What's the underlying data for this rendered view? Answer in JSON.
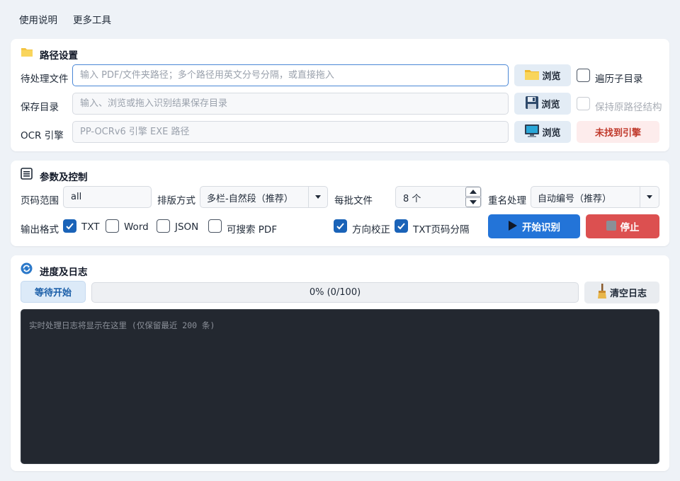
{
  "menu": {
    "usage": "使用说明",
    "more_tools": "更多工具"
  },
  "path_settings": {
    "title": "路径设置",
    "input_label": "待处理文件",
    "input_placeholder": "输入 PDF/文件夹路径；多个路径用英文分号分隔，或直接拖入",
    "output_label": "保存目录",
    "output_placeholder": "输入、浏览或拖入识别结果保存目录",
    "engine_label": "OCR 引擎",
    "engine_placeholder": "PP-OCRv6 引擎 EXE 路径",
    "browse_label": "浏览",
    "recursive_label": "遍历子目录",
    "keep_structure_label": "保持原路径结构",
    "engine_status": "未找到引擎"
  },
  "params": {
    "title": "参数及控制",
    "page_range_label": "页码范围",
    "page_range_value": "all",
    "layout_label": "排版方式",
    "layout_value": "多栏-自然段（推荐）",
    "batch_label": "每批文件",
    "batch_value": "8 个",
    "rename_label": "重名处理",
    "rename_value": "自动编号（推荐）",
    "output_format_label": "输出格式",
    "formats": [
      "TXT",
      "Word",
      "JSON",
      "可搜索 PDF"
    ],
    "orientation_label": "方向校正",
    "txt_page_sep_label": "TXT页码分隔",
    "start_label": "开始识别",
    "stop_label": "停止"
  },
  "progress": {
    "title": "进度及日志",
    "status": "等待开始",
    "progress_text": "0%  (0/100)",
    "progress_fraction": 0,
    "clear_label": "清空日志",
    "log_placeholder": "实时处理日志将显示在这里 (仅保留最近 200 条)"
  },
  "colors": {
    "accent": "#2374d8",
    "stop": "#dc5050",
    "log_bg": "#232830",
    "error_text": "#c0392b"
  }
}
